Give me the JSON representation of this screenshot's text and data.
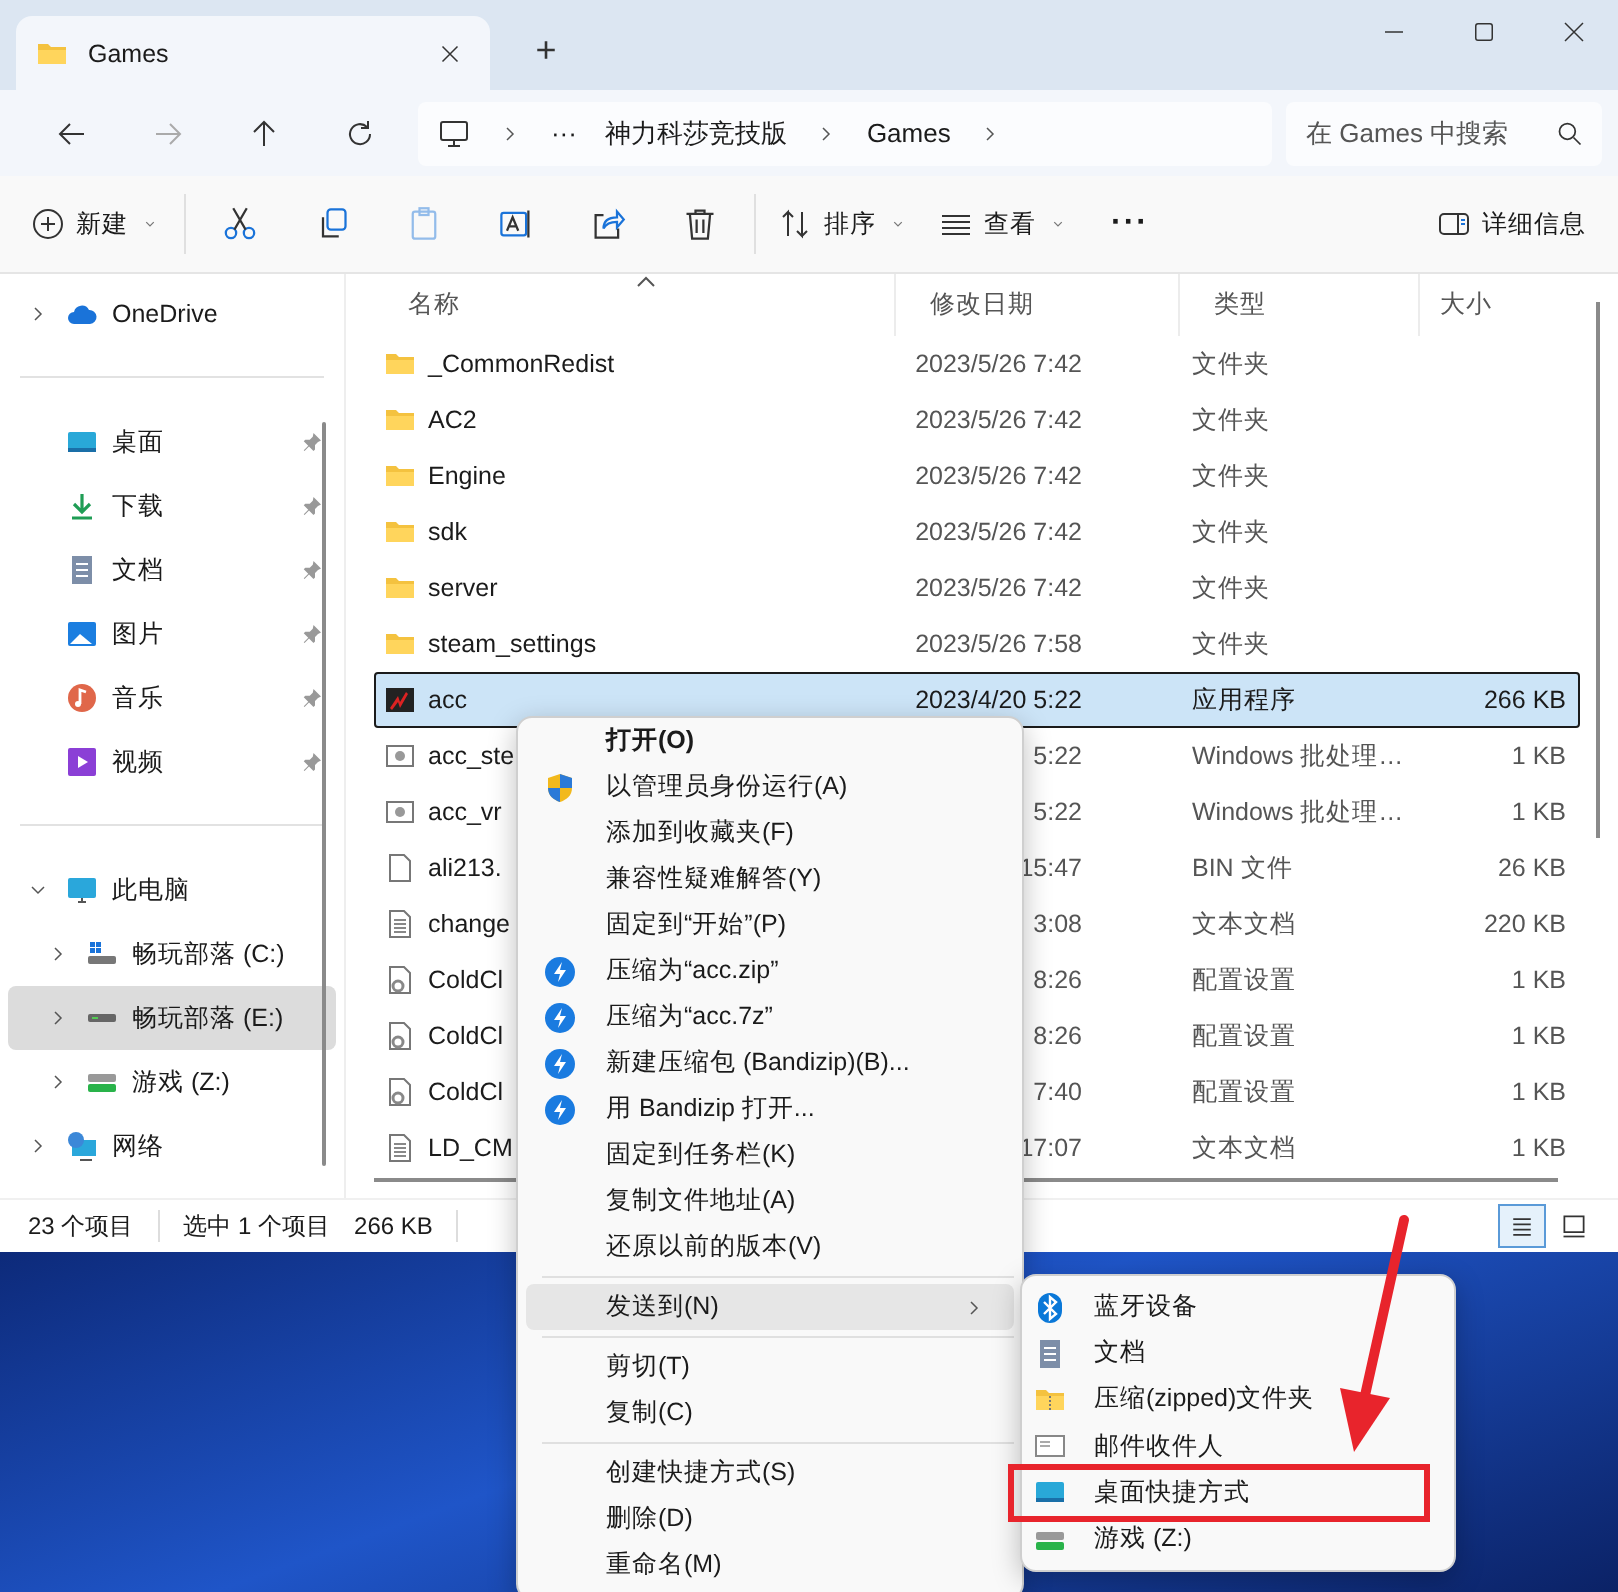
{
  "window": {
    "tab_title": "Games",
    "new_tab": "+"
  },
  "address": {
    "overflow": "···",
    "path": [
      "神力科莎竞技版",
      "Games"
    ],
    "search_placeholder": "在 Games 中搜索"
  },
  "toolbar": [
    {
      "kind": "new",
      "label": "新建",
      "disabled": false
    },
    {
      "kind": "separator"
    },
    {
      "kind": "cut",
      "disabled": false
    },
    {
      "kind": "copy",
      "disabled": false
    },
    {
      "kind": "paste",
      "disabled": true
    },
    {
      "kind": "rename",
      "disabled": false
    },
    {
      "kind": "share",
      "disabled": false
    },
    {
      "kind": "delete",
      "disabled": false
    },
    {
      "kind": "separator"
    },
    {
      "kind": "sort",
      "label": "排序",
      "disabled": false
    },
    {
      "kind": "view",
      "label": "查看",
      "disabled": false
    },
    {
      "kind": "more",
      "label": "···",
      "disabled": false
    },
    {
      "kind": "details",
      "label": "详细信息",
      "disabled": false
    }
  ],
  "sidebar": [
    {
      "kind": "cloud",
      "label": "OneDrive",
      "expanded": false,
      "selected": false
    },
    {
      "kind": "separator"
    },
    {
      "kind": "desktop",
      "label": "桌面",
      "pinned": true,
      "selected": false
    },
    {
      "kind": "download",
      "label": "下载",
      "pinned": true,
      "selected": false
    },
    {
      "kind": "document",
      "label": "文档",
      "pinned": true,
      "selected": false
    },
    {
      "kind": "picture",
      "label": "图片",
      "pinned": true,
      "selected": false
    },
    {
      "kind": "music",
      "label": "音乐",
      "pinned": true,
      "selected": false
    },
    {
      "kind": "video",
      "label": "视频",
      "pinned": true,
      "selected": false
    },
    {
      "kind": "separator"
    },
    {
      "kind": "computer",
      "label": "此电脑",
      "expanded": true,
      "selected": false,
      "children": [
        {
          "kind": "system-drive",
          "label": "畅玩部落 (C:)",
          "expanded": false,
          "selected": false
        },
        {
          "kind": "drive",
          "label": "畅玩部落 (E:)",
          "expanded": false,
          "selected": true
        },
        {
          "kind": "network-drive",
          "label": "游戏 (Z:)",
          "expanded": false,
          "selected": false
        }
      ]
    },
    {
      "kind": "network",
      "label": "网络",
      "expanded": false,
      "selected": false
    }
  ],
  "table": {
    "columns": [
      "名称",
      "修改日期",
      "类型",
      "大小"
    ],
    "rows": [
      {
        "kind": "folder",
        "name": "_CommonRedist",
        "date": "2023/5/26 7:42",
        "type": "文件夹",
        "selected": false
      },
      {
        "kind": "folder",
        "name": "AC2",
        "date": "2023/5/26 7:42",
        "type": "文件夹",
        "selected": false
      },
      {
        "kind": "folder",
        "name": "Engine",
        "date": "2023/5/26 7:42",
        "type": "文件夹",
        "selected": false
      },
      {
        "kind": "folder",
        "name": "sdk",
        "date": "2023/5/26 7:42",
        "type": "文件夹",
        "selected": false
      },
      {
        "kind": "folder",
        "name": "server",
        "date": "2023/5/26 7:42",
        "type": "文件夹",
        "selected": false
      },
      {
        "kind": "folder",
        "name": "steam_settings",
        "date": "2023/5/26 7:58",
        "type": "文件夹",
        "selected": false
      },
      {
        "kind": "app",
        "name": "acc",
        "date": "2023/4/20 5:22",
        "type": "应用程序",
        "size": "266 KB",
        "selected": true
      },
      {
        "kind": "script",
        "name": "acc_ste",
        "date": "5:22",
        "type": "Windows 批处理…",
        "size": "1 KB",
        "selected": false
      },
      {
        "kind": "script",
        "name": "acc_vr",
        "date": "5:22",
        "type": "Windows 批处理…",
        "size": "1 KB",
        "selected": false
      },
      {
        "kind": "file",
        "name": "ali213.",
        "date": "15:47",
        "type": "BIN 文件",
        "size": "26 KB",
        "selected": false
      },
      {
        "kind": "text",
        "name": "change",
        "date": "3:08",
        "type": "文本文档",
        "size": "220 KB",
        "selected": false
      },
      {
        "kind": "config",
        "name": "ColdCl",
        "date": "8:26",
        "type": "配置设置",
        "size": "1 KB",
        "selected": false
      },
      {
        "kind": "config",
        "name": "ColdCl",
        "date": "8:26",
        "type": "配置设置",
        "size": "1 KB",
        "selected": false
      },
      {
        "kind": "config",
        "name": "ColdCl",
        "date": "7:40",
        "type": "配置设置",
        "size": "1 KB",
        "selected": false
      },
      {
        "kind": "text",
        "name": "LD_CM",
        "date": "17:07",
        "type": "文本文档",
        "size": "1 KB",
        "selected": false
      }
    ]
  },
  "status_bar": {
    "count": "23 个项目",
    "selection": "选中 1 个项目",
    "size": "266 KB",
    "views": [
      {
        "kind": "details",
        "selected": true
      },
      {
        "kind": "tiles",
        "selected": false
      }
    ]
  },
  "context_menu": [
    {
      "kind": "plain",
      "label": "打开(O)",
      "default": true,
      "highlighted": false
    },
    {
      "kind": "shield",
      "label": "以管理员身份运行(A)",
      "default": false,
      "highlighted": false
    },
    {
      "kind": "plain",
      "label": "添加到收藏夹(F)",
      "default": false,
      "highlighted": false
    },
    {
      "kind": "plain",
      "label": "兼容性疑难解答(Y)",
      "default": false,
      "highlighted": false
    },
    {
      "kind": "plain",
      "label": "固定到“开始”(P)",
      "default": false,
      "highlighted": false
    },
    {
      "kind": "bandizip",
      "label": "压缩为“acc.zip”",
      "default": false,
      "highlighted": false
    },
    {
      "kind": "bandizip",
      "label": "压缩为“acc.7z”",
      "default": false,
      "highlighted": false
    },
    {
      "kind": "bandizip",
      "label": "新建压缩包 (Bandizip)(B)...",
      "default": false,
      "highlighted": false
    },
    {
      "kind": "bandizip",
      "label": "用 Bandizip 打开...",
      "default": false,
      "highlighted": false
    },
    {
      "kind": "plain",
      "label": "固定到任务栏(K)",
      "default": false,
      "highlighted": false
    },
    {
      "kind": "plain",
      "label": "复制文件地址(A)",
      "default": false,
      "highlighted": false
    },
    {
      "kind": "plain",
      "label": "还原以前的版本(V)",
      "default": false,
      "highlighted": false
    },
    {
      "kind": "separator"
    },
    {
      "kind": "submenu",
      "label": "发送到(N)",
      "default": false,
      "highlighted": true
    },
    {
      "kind": "separator"
    },
    {
      "kind": "plain",
      "label": "剪切(T)",
      "default": false,
      "highlighted": false
    },
    {
      "kind": "plain",
      "label": "复制(C)",
      "default": false,
      "highlighted": false
    },
    {
      "kind": "separator"
    },
    {
      "kind": "plain",
      "label": "创建快捷方式(S)",
      "default": false,
      "highlighted": false
    },
    {
      "kind": "plain",
      "label": "删除(D)",
      "default": false,
      "highlighted": false
    },
    {
      "kind": "plain",
      "label": "重命名(M)",
      "default": false,
      "highlighted": false
    }
  ],
  "submenu": [
    {
      "kind": "bluetooth",
      "label": "蓝牙设备",
      "annotated": false
    },
    {
      "kind": "document",
      "label": "文档",
      "annotated": false
    },
    {
      "kind": "zip-folder",
      "label": "压缩(zipped)文件夹",
      "annotated": false
    },
    {
      "kind": "mail",
      "label": "邮件收件人",
      "annotated": false
    },
    {
      "kind": "desktop",
      "label": "桌面快捷方式",
      "annotated": true
    },
    {
      "kind": "network-drive",
      "label": "游戏 (Z:)",
      "annotated": false
    }
  ]
}
